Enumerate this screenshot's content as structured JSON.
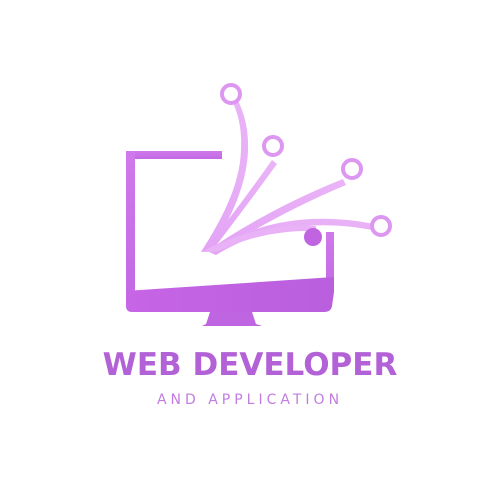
{
  "logo": {
    "icon": "monitor-circuit-icon",
    "title": "WEB DEVELOPER",
    "subtitle": "AND APPLICATION",
    "colors": {
      "primary": "#c86ce8",
      "light": "#e7a9f6",
      "dark": "#b85fdc",
      "title": "#b261d6",
      "subtitle": "#c27de0",
      "background": "#ffffff"
    }
  }
}
